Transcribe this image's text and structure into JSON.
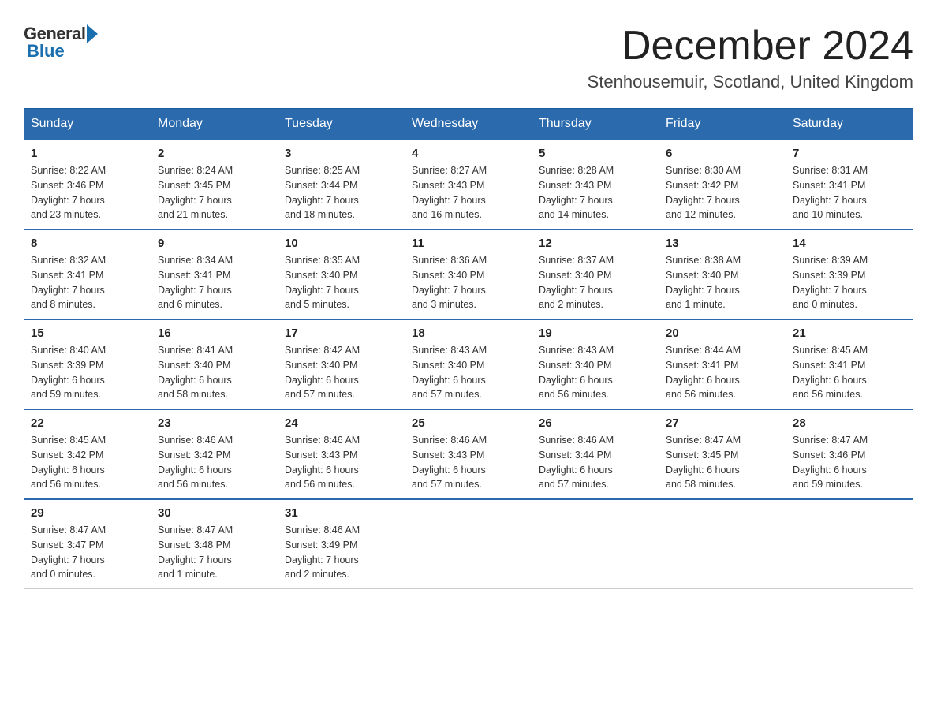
{
  "header": {
    "title": "December 2024",
    "location": "Stenhousemuir, Scotland, United Kingdom",
    "logo_general": "General",
    "logo_blue": "Blue"
  },
  "days_of_week": [
    "Sunday",
    "Monday",
    "Tuesday",
    "Wednesday",
    "Thursday",
    "Friday",
    "Saturday"
  ],
  "weeks": [
    [
      {
        "day": "1",
        "sunrise": "8:22 AM",
        "sunset": "3:46 PM",
        "daylight": "7 hours and 23 minutes."
      },
      {
        "day": "2",
        "sunrise": "8:24 AM",
        "sunset": "3:45 PM",
        "daylight": "7 hours and 21 minutes."
      },
      {
        "day": "3",
        "sunrise": "8:25 AM",
        "sunset": "3:44 PM",
        "daylight": "7 hours and 18 minutes."
      },
      {
        "day": "4",
        "sunrise": "8:27 AM",
        "sunset": "3:43 PM",
        "daylight": "7 hours and 16 minutes."
      },
      {
        "day": "5",
        "sunrise": "8:28 AM",
        "sunset": "3:43 PM",
        "daylight": "7 hours and 14 minutes."
      },
      {
        "day": "6",
        "sunrise": "8:30 AM",
        "sunset": "3:42 PM",
        "daylight": "7 hours and 12 minutes."
      },
      {
        "day": "7",
        "sunrise": "8:31 AM",
        "sunset": "3:41 PM",
        "daylight": "7 hours and 10 minutes."
      }
    ],
    [
      {
        "day": "8",
        "sunrise": "8:32 AM",
        "sunset": "3:41 PM",
        "daylight": "7 hours and 8 minutes."
      },
      {
        "day": "9",
        "sunrise": "8:34 AM",
        "sunset": "3:41 PM",
        "daylight": "7 hours and 6 minutes."
      },
      {
        "day": "10",
        "sunrise": "8:35 AM",
        "sunset": "3:40 PM",
        "daylight": "7 hours and 5 minutes."
      },
      {
        "day": "11",
        "sunrise": "8:36 AM",
        "sunset": "3:40 PM",
        "daylight": "7 hours and 3 minutes."
      },
      {
        "day": "12",
        "sunrise": "8:37 AM",
        "sunset": "3:40 PM",
        "daylight": "7 hours and 2 minutes."
      },
      {
        "day": "13",
        "sunrise": "8:38 AM",
        "sunset": "3:40 PM",
        "daylight": "7 hours and 1 minute."
      },
      {
        "day": "14",
        "sunrise": "8:39 AM",
        "sunset": "3:39 PM",
        "daylight": "7 hours and 0 minutes."
      }
    ],
    [
      {
        "day": "15",
        "sunrise": "8:40 AM",
        "sunset": "3:39 PM",
        "daylight": "6 hours and 59 minutes."
      },
      {
        "day": "16",
        "sunrise": "8:41 AM",
        "sunset": "3:40 PM",
        "daylight": "6 hours and 58 minutes."
      },
      {
        "day": "17",
        "sunrise": "8:42 AM",
        "sunset": "3:40 PM",
        "daylight": "6 hours and 57 minutes."
      },
      {
        "day": "18",
        "sunrise": "8:43 AM",
        "sunset": "3:40 PM",
        "daylight": "6 hours and 57 minutes."
      },
      {
        "day": "19",
        "sunrise": "8:43 AM",
        "sunset": "3:40 PM",
        "daylight": "6 hours and 56 minutes."
      },
      {
        "day": "20",
        "sunrise": "8:44 AM",
        "sunset": "3:41 PM",
        "daylight": "6 hours and 56 minutes."
      },
      {
        "day": "21",
        "sunrise": "8:45 AM",
        "sunset": "3:41 PM",
        "daylight": "6 hours and 56 minutes."
      }
    ],
    [
      {
        "day": "22",
        "sunrise": "8:45 AM",
        "sunset": "3:42 PM",
        "daylight": "6 hours and 56 minutes."
      },
      {
        "day": "23",
        "sunrise": "8:46 AM",
        "sunset": "3:42 PM",
        "daylight": "6 hours and 56 minutes."
      },
      {
        "day": "24",
        "sunrise": "8:46 AM",
        "sunset": "3:43 PM",
        "daylight": "6 hours and 56 minutes."
      },
      {
        "day": "25",
        "sunrise": "8:46 AM",
        "sunset": "3:43 PM",
        "daylight": "6 hours and 57 minutes."
      },
      {
        "day": "26",
        "sunrise": "8:46 AM",
        "sunset": "3:44 PM",
        "daylight": "6 hours and 57 minutes."
      },
      {
        "day": "27",
        "sunrise": "8:47 AM",
        "sunset": "3:45 PM",
        "daylight": "6 hours and 58 minutes."
      },
      {
        "day": "28",
        "sunrise": "8:47 AM",
        "sunset": "3:46 PM",
        "daylight": "6 hours and 59 minutes."
      }
    ],
    [
      {
        "day": "29",
        "sunrise": "8:47 AM",
        "sunset": "3:47 PM",
        "daylight": "7 hours and 0 minutes."
      },
      {
        "day": "30",
        "sunrise": "8:47 AM",
        "sunset": "3:48 PM",
        "daylight": "7 hours and 1 minute."
      },
      {
        "day": "31",
        "sunrise": "8:46 AM",
        "sunset": "3:49 PM",
        "daylight": "7 hours and 2 minutes."
      },
      null,
      null,
      null,
      null
    ]
  ],
  "labels": {
    "sunrise": "Sunrise:",
    "sunset": "Sunset:",
    "daylight": "Daylight:"
  }
}
